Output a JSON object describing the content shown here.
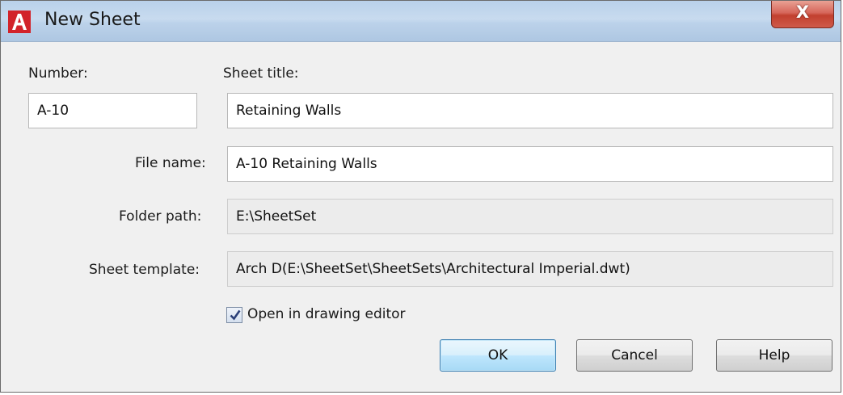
{
  "window": {
    "title": "New Sheet",
    "close_glyph": "X",
    "app_icon": "autocad-icon"
  },
  "form": {
    "number_label": "Number:",
    "number_value": "A-10",
    "sheet_title_label": "Sheet title:",
    "sheet_title_value": "Retaining Walls",
    "file_name_label": "File name:",
    "file_name_value": "A-10 Retaining Walls",
    "folder_path_label": "Folder path:",
    "folder_path_value": "E:\\SheetSet",
    "sheet_template_label": "Sheet template:",
    "sheet_template_value": "Arch D(E:\\SheetSet\\SheetSets\\Architectural Imperial.dwt)",
    "open_in_editor_label": "Open in drawing editor",
    "open_in_editor_checked": true
  },
  "buttons": {
    "ok": "OK",
    "cancel": "Cancel",
    "help": "Help"
  },
  "colors": {
    "app_icon_red": "#d2232a",
    "close_button_red": "#c8463a",
    "default_button_border": "#3c7fb1"
  }
}
